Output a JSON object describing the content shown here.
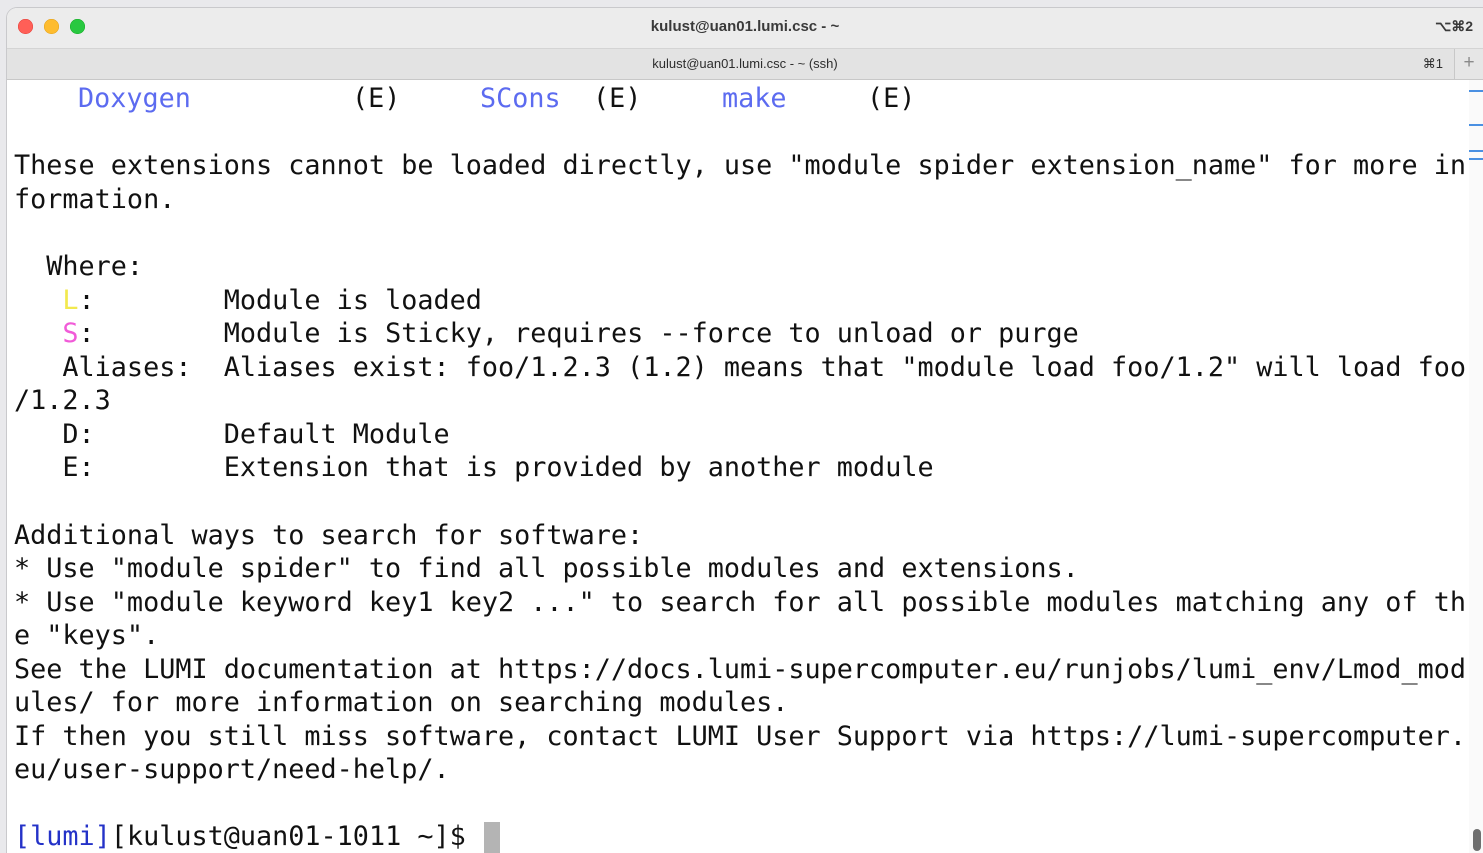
{
  "window": {
    "title": "kulust@uan01.lumi.csc - ~",
    "shortcut": "⌥⌘2"
  },
  "tab": {
    "title": "kulust@uan01.lumi.csc - ~ (ssh)",
    "shortcut": "⌘1",
    "add_symbol": "+"
  },
  "terminal": {
    "extensions": [
      {
        "name": "Doxygen",
        "tag": "(E)"
      },
      {
        "name": "SCons",
        "tag": "(E)"
      },
      {
        "name": "make",
        "tag": "(E)"
      }
    ],
    "note_line1": "These extensions cannot be loaded directly, use \"module spider extension_name\" for more in",
    "note_line2": "formation.",
    "where_heading": "  Where:",
    "legend": {
      "L_key": "L",
      "L_desc": "Module is loaded",
      "S_key": "S",
      "S_desc": "Module is Sticky, requires --force to unload or purge",
      "aliases_key": "   Aliases:  ",
      "aliases_desc": "Aliases exist: foo/1.2.3 (1.2) means that \"module load foo/1.2\" will load foo",
      "aliases_wrap": "/1.2.3",
      "D_key": "   D:        ",
      "D_desc": "Default Module",
      "E_key": "   E:        ",
      "E_desc": "Extension that is provided by another module"
    },
    "additional_heading": "Additional ways to search for software:",
    "bullet1": "* Use \"module spider\" to find all possible modules and extensions.",
    "bullet2_line1": "* Use \"module keyword key1 key2 ...\" to search for all possible modules matching any of th",
    "bullet2_line2": "e \"keys\".",
    "see_line1": "See the LUMI documentation at https://docs.lumi-supercomputer.eu/runjobs/lumi_env/Lmod_mod",
    "see_line2": "ules/ for more information on searching modules.",
    "if_line1": "If then you still miss software, contact LUMI User Support via https://lumi-supercomputer.",
    "if_line2": "eu/user-support/need-help/.",
    "prompt_tag": "[lumi]",
    "prompt_rest": "[kulust@uan01-1011 ~]$ "
  },
  "colors": {
    "extension_name": "#5c6bf0",
    "loaded_key": "#f2e94e",
    "sticky_key": "#f15bd8",
    "prompt_tag": "#2432c8"
  }
}
